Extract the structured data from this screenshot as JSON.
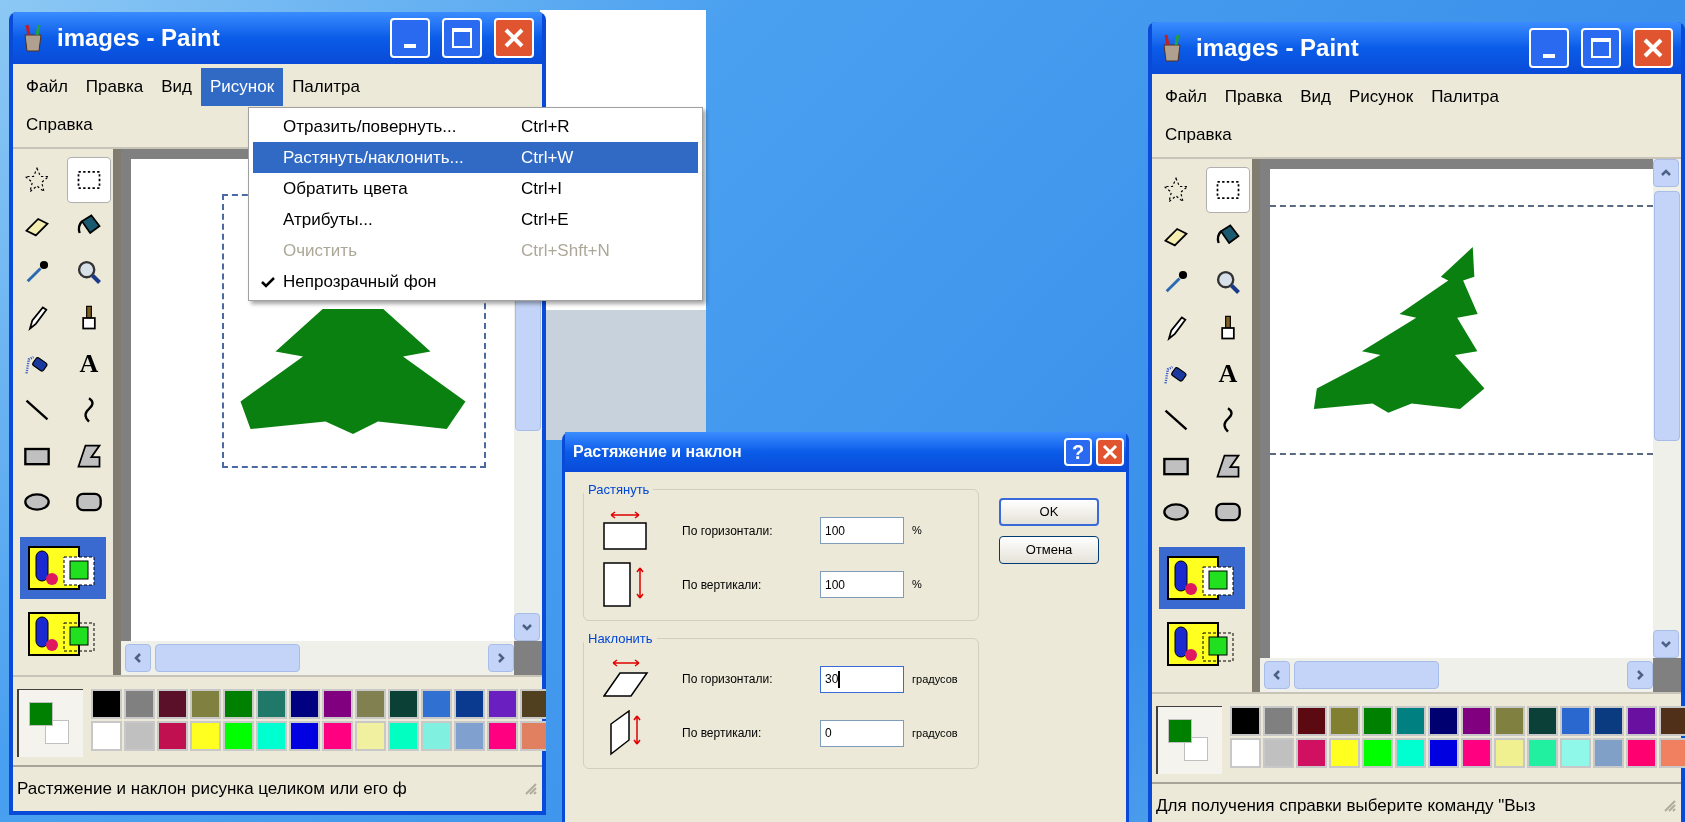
{
  "paint_windows": [
    {
      "kind": "menu-open",
      "title": "images - Paint",
      "menu": [
        {
          "label": "Файл",
          "selected": false
        },
        {
          "label": "Правка",
          "selected": false
        },
        {
          "label": "Вид",
          "selected": false
        },
        {
          "label": "Рисунок",
          "selected": true
        },
        {
          "label": "Палитра",
          "selected": false
        },
        {
          "label": "Справка",
          "selected": false
        }
      ],
      "tools": [
        {
          "kind": "free-select",
          "selected": false
        },
        {
          "kind": "select",
          "selected": true
        },
        {
          "kind": "eraser",
          "selected": false
        },
        {
          "kind": "fill",
          "selected": false
        },
        {
          "kind": "picker",
          "selected": false
        },
        {
          "kind": "magnifier",
          "selected": false
        },
        {
          "kind": "pencil",
          "selected": false
        },
        {
          "kind": "brush",
          "selected": false
        },
        {
          "kind": "airbrush",
          "selected": false
        },
        {
          "kind": "text",
          "glyph": "A",
          "selected": false
        },
        {
          "kind": "line",
          "selected": false
        },
        {
          "kind": "curve",
          "selected": false
        },
        {
          "kind": "rectangle",
          "selected": false
        },
        {
          "kind": "polygon",
          "selected": false
        },
        {
          "kind": "ellipse",
          "selected": false
        },
        {
          "kind": "rounded-rectangle",
          "selected": false
        }
      ],
      "options": [
        {
          "selected": true
        },
        {
          "selected": false
        }
      ],
      "current_colors": [
        {
          "color": "#008000"
        },
        {
          "color": "#ffffff"
        }
      ],
      "palette": [
        {
          "color": "#000000"
        },
        {
          "color": "#808080"
        },
        {
          "color": "#5a1028"
        },
        {
          "color": "#808040"
        },
        {
          "color": "#008000"
        },
        {
          "color": "#207868"
        },
        {
          "color": "#000080"
        },
        {
          "color": "#800080"
        },
        {
          "color": "#808050"
        },
        {
          "color": "#0a4035"
        },
        {
          "color": "#3070d0"
        },
        {
          "color": "#0a3a90"
        },
        {
          "color": "#6a20c0"
        },
        {
          "color": "#504020"
        },
        {
          "color": "#ffffff"
        },
        {
          "color": "#c0c0c0"
        },
        {
          "color": "#c01050"
        },
        {
          "color": "#ffff20"
        },
        {
          "color": "#00ff00"
        },
        {
          "color": "#00ffd0"
        },
        {
          "color": "#0000e0"
        },
        {
          "color": "#ff0080"
        },
        {
          "color": "#f0f0a0"
        },
        {
          "color": "#00ffc0"
        },
        {
          "color": "#80f0e0"
        },
        {
          "color": "#80a0d0"
        },
        {
          "color": "#ff0080"
        },
        {
          "color": "#e08060"
        }
      ],
      "image": {
        "kind": "upright"
      },
      "status": "Растяжение и наклон рисунка целиком или его ф"
    },
    {
      "kind": "plain",
      "title": "images - Paint",
      "menu": [
        {
          "label": "Файл",
          "selected": false
        },
        {
          "label": "Правка",
          "selected": false
        },
        {
          "label": "Вид",
          "selected": false
        },
        {
          "label": "Рисунок",
          "selected": false
        },
        {
          "label": "Палитра",
          "selected": false
        },
        {
          "label": "Справка",
          "selected": false
        }
      ],
      "tools": [
        {
          "kind": "free-select",
          "selected": false
        },
        {
          "kind": "select",
          "selected": true
        },
        {
          "kind": "eraser",
          "selected": false
        },
        {
          "kind": "fill",
          "selected": false
        },
        {
          "kind": "picker",
          "selected": false
        },
        {
          "kind": "magnifier",
          "selected": false
        },
        {
          "kind": "pencil",
          "selected": false
        },
        {
          "kind": "brush",
          "selected": false
        },
        {
          "kind": "airbrush",
          "selected": false
        },
        {
          "kind": "text",
          "glyph": "A",
          "selected": false
        },
        {
          "kind": "line",
          "selected": false
        },
        {
          "kind": "curve",
          "selected": false
        },
        {
          "kind": "rectangle",
          "selected": false
        },
        {
          "kind": "polygon",
          "selected": false
        },
        {
          "kind": "ellipse",
          "selected": false
        },
        {
          "kind": "rounded-rectangle",
          "selected": false
        }
      ],
      "options": [
        {
          "selected": true
        },
        {
          "selected": false
        }
      ],
      "current_colors": [
        {
          "color": "#008000"
        },
        {
          "color": "#ffffff"
        }
      ],
      "palette": [
        {
          "color": "#000000"
        },
        {
          "color": "#808080"
        },
        {
          "color": "#5a0a10"
        },
        {
          "color": "#808030"
        },
        {
          "color": "#008000"
        },
        {
          "color": "#008080"
        },
        {
          "color": "#000070"
        },
        {
          "color": "#800080"
        },
        {
          "color": "#808040"
        },
        {
          "color": "#0a4038"
        },
        {
          "color": "#2a68d0"
        },
        {
          "color": "#0a3a80"
        },
        {
          "color": "#6a10a0"
        },
        {
          "color": "#503018"
        },
        {
          "color": "#ffffff"
        },
        {
          "color": "#c0c0c0"
        },
        {
          "color": "#d01060"
        },
        {
          "color": "#ffff20"
        },
        {
          "color": "#00ff00"
        },
        {
          "color": "#00ffd0"
        },
        {
          "color": "#0000e0"
        },
        {
          "color": "#ff0080"
        },
        {
          "color": "#f0f090"
        },
        {
          "color": "#20f0a0"
        },
        {
          "color": "#90f8e8"
        },
        {
          "color": "#80a0c8"
        },
        {
          "color": "#ff0070"
        },
        {
          "color": "#f08060"
        }
      ],
      "image": {
        "kind": "skewed"
      },
      "status": "Для получения справки выберите команду \"Выз"
    }
  ],
  "picture_menu": {
    "items": [
      {
        "label": "Отразить/повернуть...",
        "shortcut": "Ctrl+R",
        "selected": false,
        "disabled": false,
        "checked": false
      },
      {
        "label": "Растянуть/наклонить...",
        "shortcut": "Ctrl+W",
        "selected": true,
        "disabled": false,
        "checked": false
      },
      {
        "label": "Обратить цвета",
        "shortcut": "Ctrl+I",
        "selected": false,
        "disabled": false,
        "checked": false
      },
      {
        "label": "Атрибуты...",
        "shortcut": "Ctrl+E",
        "selected": false,
        "disabled": false,
        "checked": false
      },
      {
        "label": "Очистить",
        "shortcut": "Ctrl+Shft+N",
        "selected": false,
        "disabled": true,
        "checked": false
      },
      {
        "label": "Непрозрачный фон",
        "selected": false,
        "disabled": false,
        "checked": true
      }
    ]
  },
  "dialog": {
    "title": "Растяжение и наклон",
    "help": "?",
    "groups": [
      {
        "title": "Растянуть",
        "rows": [
          {
            "kind": "horizontal-stretch",
            "label": "По горизонтали:",
            "value": "100",
            "unit": "%",
            "focused": false
          },
          {
            "kind": "vertical-stretch",
            "label": "По вертикали:",
            "value": "100",
            "unit": "%",
            "focused": false
          }
        ]
      },
      {
        "title": "Наклонить",
        "rows": [
          {
            "kind": "horizontal-skew",
            "label": "По горизонтали:",
            "value": "30",
            "unit": "градусов",
            "focused": true
          },
          {
            "kind": "vertical-skew",
            "label": "По вертикали:",
            "value": "0",
            "unit": "градусов",
            "focused": false
          }
        ]
      }
    ],
    "buttons": [
      {
        "label": "OK",
        "default": true
      },
      {
        "label": "Отмена",
        "default": false
      }
    ]
  }
}
